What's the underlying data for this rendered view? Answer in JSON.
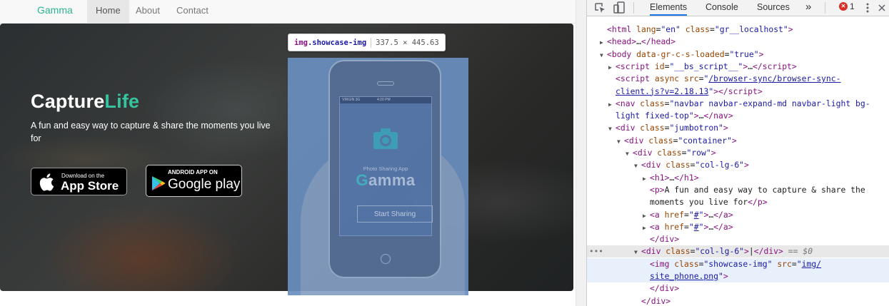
{
  "site": {
    "brand": "Gamma",
    "nav": [
      "Home",
      "About",
      "Contact"
    ],
    "active_nav": "Home",
    "hero_title_main": "Capture",
    "hero_title_accent": "Life",
    "hero_text": "A fun and easy way to capture & share the moments you live for",
    "appstore": {
      "small": "Download on the",
      "big": "App Store"
    },
    "googleplay": {
      "small": "ANDROID APP ON",
      "big": "Google play"
    },
    "phone": {
      "status_left": "VIRGIN 3G",
      "status_time": "4:20 PM",
      "caption": "Photo Sharing App",
      "app_name_first": "G",
      "app_name_rest": "amma",
      "button": "Start Sharing"
    },
    "tooltip": {
      "tag": "img",
      "class": ".showcase-img",
      "dims": "337.5 × 445.63"
    }
  },
  "devtools": {
    "tabs": [
      "Elements",
      "Console",
      "Sources"
    ],
    "active_tab": "Elements",
    "more": "»",
    "error_count": "1",
    "error_badge": "✕"
  },
  "dom": [
    {
      "indent": 1,
      "tri": "",
      "html": "<span class=t>&lt;html</span> <span class=a>lang</span>=<span class=v>\"en\"</span> <span class=a>class</span>=<span class=v>\"gr__localhost\"</span><span class=t>&gt;</span>"
    },
    {
      "indent": 1,
      "tri": "▶",
      "html": "<span class=t>&lt;head&gt;</span>…<span class=t>&lt;/head&gt;</span>"
    },
    {
      "indent": 1,
      "tri": "▼",
      "html": "<span class=t>&lt;body</span> <span class=a>data-gr-c-s-loaded</span>=<span class=v>\"true\"</span><span class=t>&gt;</span>"
    },
    {
      "indent": 2,
      "tri": "▶",
      "html": "<span class=t>&lt;script</span> <span class=a>id</span>=<span class=v>\"__bs_script__\"</span><span class=t>&gt;</span>…<span class=t>&lt;/script&gt;</span>"
    },
    {
      "indent": 2,
      "tri": "",
      "html": "<span class=t>&lt;script</span> <span class=a>async</span> <span class=a>src</span>=<span class=v>\"</span><span class=u>/browser-sync/browser-sync-</span>"
    },
    {
      "indent": 2,
      "tri": "",
      "html": "<span class=u>client.js?v=2.18.13</span><span class=v>\"</span><span class=t>&gt;&lt;/script&gt;</span>"
    },
    {
      "indent": 2,
      "tri": "▶",
      "html": "<span class=t>&lt;nav</span> <span class=a>class</span>=<span class=v>\"navbar navbar-expand-md navbar-light bg-</span>"
    },
    {
      "indent": 2,
      "tri": "",
      "html": "<span class=v>light fixed-top\"</span><span class=t>&gt;</span>…<span class=t>&lt;/nav&gt;</span>"
    },
    {
      "indent": 2,
      "tri": "▼",
      "html": "<span class=t>&lt;div</span> <span class=a>class</span>=<span class=v>\"jumbotron\"</span><span class=t>&gt;</span>"
    },
    {
      "indent": 3,
      "tri": "▼",
      "html": "<span class=t>&lt;div</span> <span class=a>class</span>=<span class=v>\"container\"</span><span class=t>&gt;</span>"
    },
    {
      "indent": 4,
      "tri": "▼",
      "html": "<span class=t>&lt;div</span> <span class=a>class</span>=<span class=v>\"row\"</span><span class=t>&gt;</span>"
    },
    {
      "indent": 5,
      "tri": "▼",
      "html": "<span class=t>&lt;div</span> <span class=a>class</span>=<span class=v>\"col-lg-6\"</span><span class=t>&gt;</span>"
    },
    {
      "indent": 6,
      "tri": "▶",
      "html": "<span class=t>&lt;h1&gt;</span>…<span class=t>&lt;/h1&gt;</span>"
    },
    {
      "indent": 6,
      "tri": "",
      "html": "<span class=t>&lt;p&gt;</span><span class=c>A fun and easy way to capture &amp; share the</span>"
    },
    {
      "indent": 6,
      "tri": "",
      "html": "<span class=c>moments you live for</span><span class=t>&lt;/p&gt;</span>"
    },
    {
      "indent": 6,
      "tri": "▶",
      "html": "<span class=t>&lt;a</span> <span class=a>href</span>=<span class=v>\"</span><span class=u>#</span><span class=v>\"</span><span class=t>&gt;</span>…<span class=t>&lt;/a&gt;</span>"
    },
    {
      "indent": 6,
      "tri": "▶",
      "html": "<span class=t>&lt;a</span> <span class=a>href</span>=<span class=v>\"</span><span class=u>#</span><span class=v>\"</span><span class=t>&gt;</span>…<span class=t>&lt;/a&gt;</span>"
    },
    {
      "indent": 6,
      "tri": "",
      "html": "<span class=t>&lt;/div&gt;</span>"
    },
    {
      "indent": 5,
      "tri": "▼",
      "html": "<span class=t>&lt;div</span> <span class=a>class</span>=<span class=v>\"col-lg-6\"</span><span class=t>&gt;</span>|<span class=t>&lt;/div&gt;</span> <span class=eq>== $0</span>",
      "state": "selected"
    },
    {
      "indent": 6,
      "tri": "",
      "html": "<span class=t>&lt;img</span> <span class=a>class</span>=<span class=v>\"showcase-img\"</span> <span class=a>src</span>=<span class=v>\"</span><span class=u>img/</span>",
      "state": "hover"
    },
    {
      "indent": 6,
      "tri": "",
      "html": "<span class=u>site_phone.png</span><span class=v>\"</span><span class=t>&gt;</span>",
      "state": "hover"
    },
    {
      "indent": 6,
      "tri": "",
      "html": "<span class=t>&lt;/div&gt;</span>"
    },
    {
      "indent": 5,
      "tri": "",
      "html": "<span class=t>&lt;/div&gt;</span>"
    }
  ]
}
